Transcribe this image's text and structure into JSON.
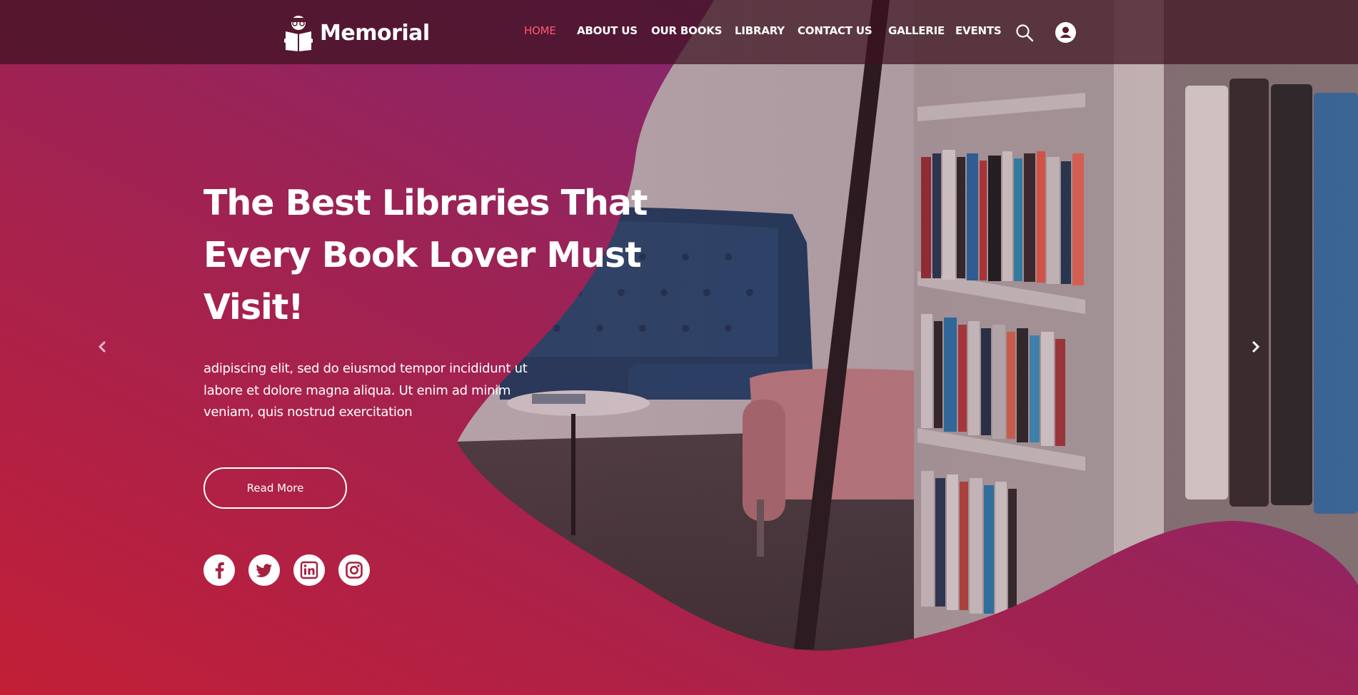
{
  "brand": {
    "name": "Memorial"
  },
  "nav": {
    "items": [
      {
        "label": "HOME",
        "active": true
      },
      {
        "label": "ABOUT US",
        "active": false
      },
      {
        "label": "OUR BOOKS",
        "active": false
      },
      {
        "label": "LIBRARY",
        "active": false
      },
      {
        "label": "CONTACT US",
        "active": false
      },
      {
        "label": "GALLERIE",
        "active": false
      },
      {
        "label": "EVENTS",
        "active": false
      }
    ],
    "icons": {
      "search": "search-icon",
      "account": "user-icon"
    }
  },
  "hero": {
    "title_lines": [
      "The Best Libraries That",
      "Every Book Lover Must",
      "Visit!"
    ],
    "description_lines": [
      "adipiscing elit, sed do eiusmod tempor incididunt ut",
      "labore et dolore magna aliqua. Ut enim ad minim",
      "veniam, quis nostrud exercitation"
    ],
    "button_label": "Read More"
  },
  "social": [
    "facebook-icon",
    "twitter-icon",
    "linkedin-icon",
    "instagram-icon"
  ],
  "slider": {
    "prev": "chevron-left-icon",
    "next": "chevron-right-icon"
  },
  "colors": {
    "gradient_start": "#c21f37",
    "gradient_mid": "#9b2356",
    "gradient_end": "#722a8c",
    "nav_active": "#ff5a6e",
    "social_icon": "#a5213f"
  }
}
